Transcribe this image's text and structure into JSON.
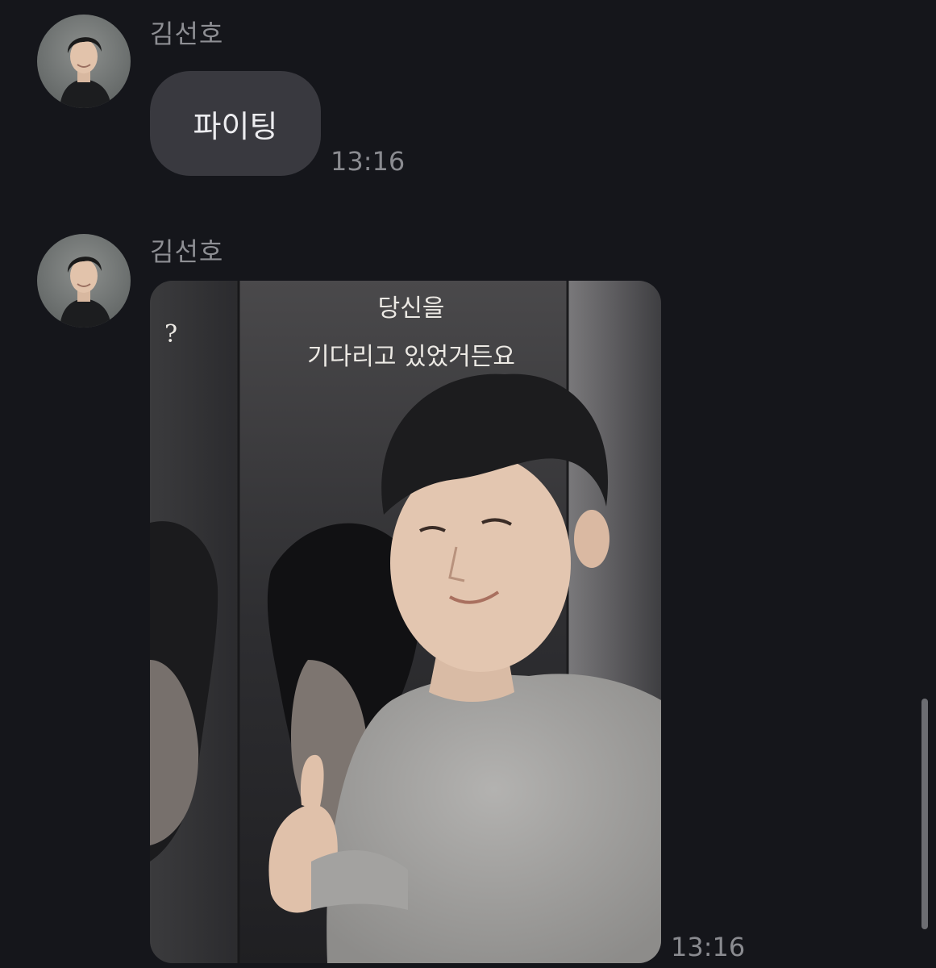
{
  "messages": [
    {
      "sender": "김선호",
      "type": "text",
      "text": "파이팅",
      "time": "13:16",
      "avatar_icon": "profile-photo"
    },
    {
      "sender": "김선호",
      "type": "photo",
      "photo_text": [
        "당신을",
        "기다리고 있었거든요"
      ],
      "photo_partial_text": "?",
      "time": "13:16",
      "avatar_icon": "profile-photo"
    }
  ],
  "colors": {
    "background": "#15161b",
    "bubble": "#39393f",
    "text_muted": "#8e8f94"
  }
}
